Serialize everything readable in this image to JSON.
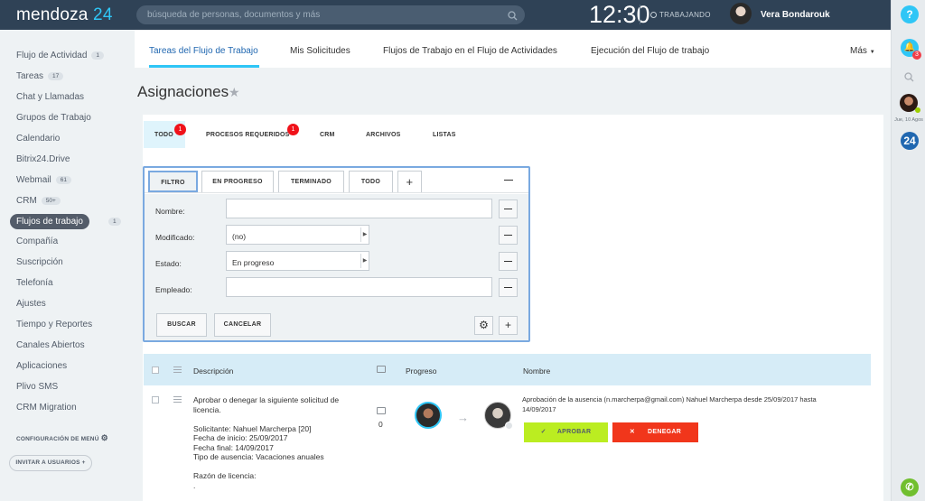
{
  "topbar": {
    "logo_main": "mendoza",
    "logo_num": "24",
    "search_placeholder": "búsqueda de personas, documentos y más",
    "clock": "12:30",
    "work_status": "TRABAJANDO",
    "user_name": "Vera Bondarouk"
  },
  "rail": {
    "help": "?",
    "notif_count": "3",
    "date": "Jue, 10 Agos",
    "b24": "24"
  },
  "sidebar": {
    "items": [
      {
        "label": "Flujo de Actividad",
        "count": "1"
      },
      {
        "label": "Tareas",
        "count": "17"
      },
      {
        "label": "Chat y Llamadas",
        "count": ""
      },
      {
        "label": "Grupos de Trabajo",
        "count": ""
      },
      {
        "label": "Calendario",
        "count": ""
      },
      {
        "label": "Bitrix24.Drive",
        "count": ""
      },
      {
        "label": "Webmail",
        "count": "61"
      },
      {
        "label": "CRM",
        "count": "50+"
      },
      {
        "label": "Flujos de trabajo",
        "count": "1"
      },
      {
        "label": "Compañía",
        "count": ""
      },
      {
        "label": "Suscripción",
        "count": ""
      },
      {
        "label": "Telefonía",
        "count": ""
      },
      {
        "label": "Ajustes",
        "count": ""
      },
      {
        "label": "Tiempo y Reportes",
        "count": ""
      },
      {
        "label": "Canales Abiertos",
        "count": ""
      },
      {
        "label": "Aplicaciones",
        "count": ""
      },
      {
        "label": "Plivo SMS",
        "count": ""
      },
      {
        "label": "CRM Migration",
        "count": ""
      }
    ],
    "config_menu": "CONFIGURACIÓN DE MENÚ",
    "invite": "INVITAR A USUARIOS"
  },
  "topnav": {
    "tabs": [
      "Tareas del Flujo de Trabajo",
      "Mis Solicitudes",
      "Flujos de Trabajo en el Flujo de Actividades",
      "Ejecución del Flujo de trabajo"
    ],
    "more": "Más"
  },
  "page": {
    "title": "Asignaciones"
  },
  "tabs": [
    {
      "label": "TODO",
      "badge": "1"
    },
    {
      "label": "PROCESOS REQUERIDOS",
      "badge": "1"
    },
    {
      "label": "CRM",
      "badge": ""
    },
    {
      "label": "ARCHIVOS",
      "badge": ""
    },
    {
      "label": "LISTAS",
      "badge": ""
    }
  ],
  "filter": {
    "presets": [
      "FILTRO",
      "EN PROGRESO",
      "TERMINADO",
      "TODO"
    ],
    "fields": [
      {
        "label": "Nombre:",
        "value": ""
      },
      {
        "label": "Modificado:",
        "value": "(no)"
      },
      {
        "label": "Estado:",
        "value": "En progreso"
      },
      {
        "label": "Empleado:",
        "value": ""
      }
    ],
    "search_btn": "BUSCAR",
    "cancel_btn": "CANCELAR"
  },
  "table": {
    "headers": [
      "Descripción",
      "Progreso",
      "Nombre"
    ],
    "row": {
      "desc": [
        "Aprobar o denegar la siguiente solicitud de",
        "licencia.",
        "",
        "Solicitante: Nahuel Marcherpa [20]",
        "Fecha de inicio: 25/09/2017",
        "Fecha final: 14/09/2017",
        "Tipo de ausencia: Vacaciones anuales",
        "",
        "Razón de licencia:",
        "."
      ],
      "comments": "0",
      "name_line1": "Aprobación de la ausencia (n.marcherpa@gmail.com) Nahuel Marcherpa desde 25/09/2017 hasta",
      "name_line2": "14/09/2017",
      "approve": "APROBAR",
      "deny": "DENEGAR"
    }
  }
}
